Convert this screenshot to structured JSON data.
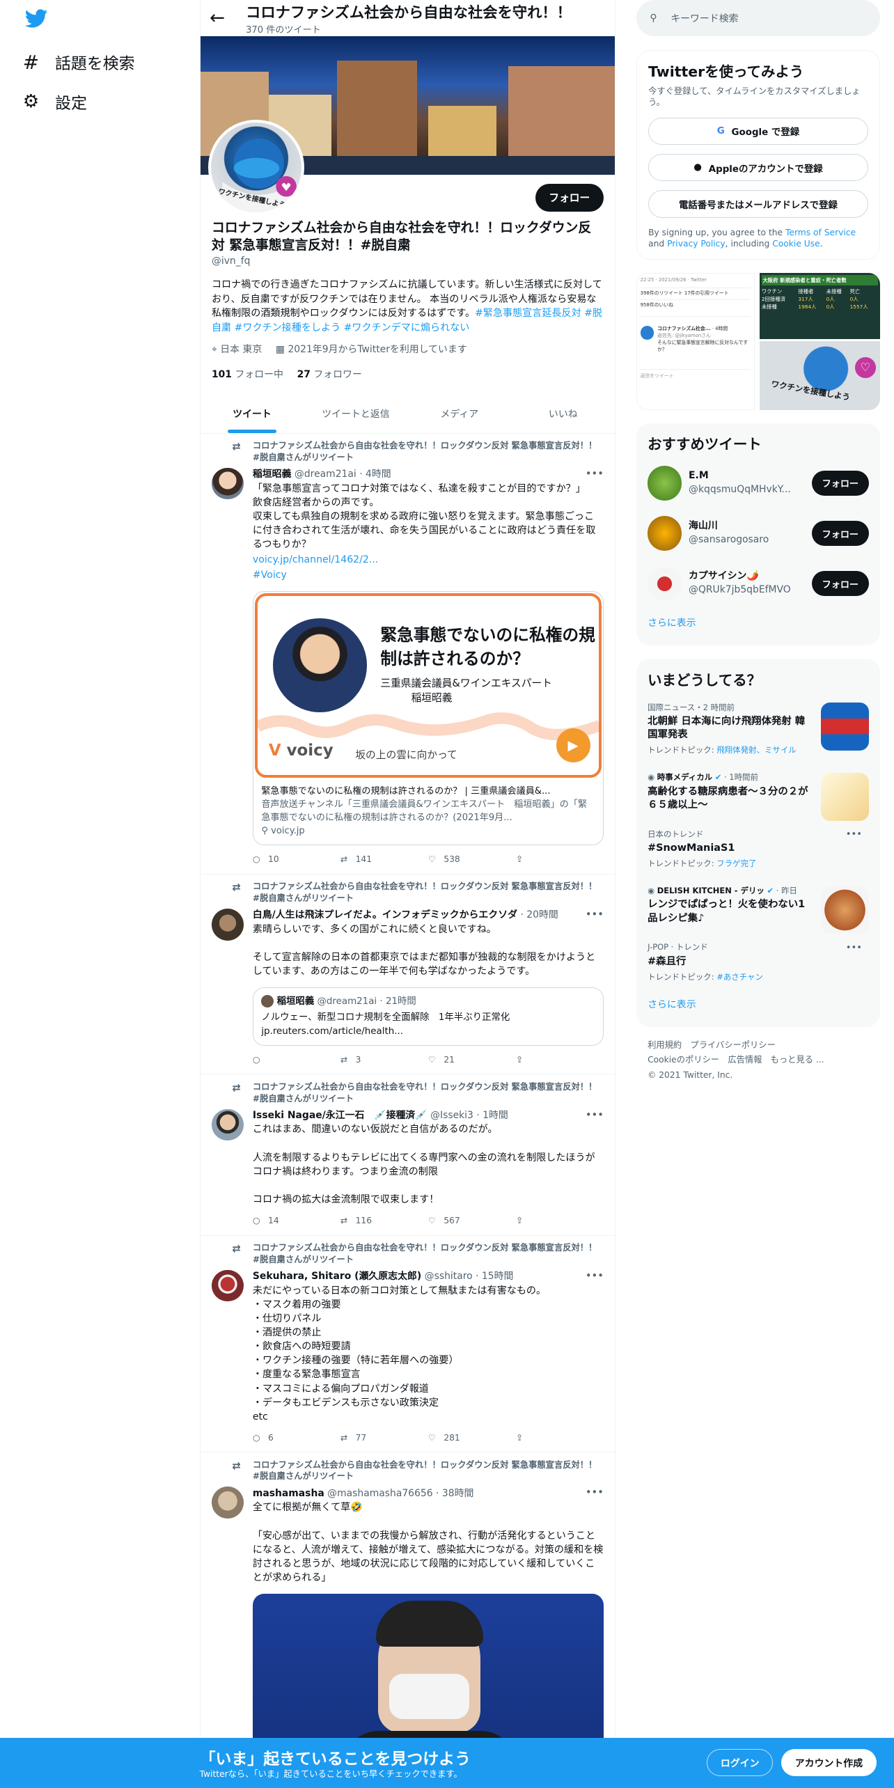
{
  "nav": {
    "explore": "話題を検索",
    "settings": "設定"
  },
  "header": {
    "title": "コロナファシズム社会から自由な社会を守れ！！ロックダウン反対 緊急事態宣言反対！！#脱自粛",
    "tweet_count": "370 件のツイート"
  },
  "profile": {
    "follow": "フォロー",
    "name": "コロナファシズム社会から自由な社会を守れ！！ロックダウン反対 緊急事態宣言反対！！#脱自粛",
    "handle": "@ivn_fq",
    "bio": "コロナ禍での行き過ぎたコロナファシズムに抗議しています。新しい生活様式に反対しており、反自粛ですが反ワクチンでは在りません。 本当のリベラル派や人権派なら安易な私権制限の酒類規制やロックダウンには反対するはずです。",
    "bio_tags": "#緊急事態宣言延長反対 #脱自粛 #ワクチン接種をしよう #ワクチンデマに煽られない",
    "location": "日本 東京",
    "joined": "2021年9月からTwitterを利用しています",
    "following": "101",
    "following_label": "フォロー中",
    "followers": "27",
    "followers_label": "フォロワー",
    "avatar_text": "ワクチンを接種しよう"
  },
  "tabs": [
    "ツイート",
    "ツイートと返信",
    "メディア",
    "いいね"
  ],
  "tweets": [
    {
      "rt": "コロナファシズム社会から自由な社会を守れ！！ロックダウン反対 緊急事態宣言反対！！#脱自粛さんがリツイート",
      "name": "稲垣昭義",
      "handle": "@dream21ai",
      "time": "· 4時間",
      "body": "「緊急事態宣言ってコロナ対策ではなく、私達を殺すことが目的ですか？」\n飲食店経営者からの声です。\n収束しても県独自の規制を求める政府に強い怒りを覚えます。緊急事態ごっこに付き合わされて生活が壊れ、命を失う国民がいることに政府はどう責任を取るつもりか？",
      "link": "voicy.jp/channel/1462/2...",
      "tag": "#Voicy",
      "card": {
        "headline": "緊急事態でないのに私権の規制は許されるのか？",
        "sub1": "三重県議会議員&ワインエキスパート",
        "sub2": "稲垣昭義",
        "brand": "voicy",
        "tagline": "坂の上の雲に向かって",
        "title": "緊急事態でないのに私権の規制は許されるのか？ | 三重県議会議員&...",
        "desc": "音声放送チャンネル「三重県議会議員&ワインエキスパート　稲垣昭義」の「緊急事態でないのに私権の規制は許されるのか？(2021年9月...",
        "domain": "voicy.jp"
      },
      "reply": "10",
      "retweet": "141",
      "like": "538"
    },
    {
      "rt": "コロナファシズム社会から自由な社会を守れ！！ロックダウン反対 緊急事態宣言反対！！#脱自粛さんがリツイート",
      "name": "白鳥/人生は飛沫プレイだよ。インフォデミックからエクソダ",
      "handle": "",
      "time": "· 20時間",
      "body": "素晴らしいです、多くの国がこれに続くと良いですね。\n\nそして宣言解除の日本の首都東京ではまだ都知事が独裁的な制限をかけようとしています、あの方はこの一年半で何も学ばなかったようです。",
      "quote": {
        "name": "稲垣昭義",
        "handle": "@dream21ai",
        "time": "· 21時間",
        "text": "ノルウェー、新型コロナ規制を全面解除　1年半ぶり正常化",
        "link": "jp.reuters.com/article/health..."
      },
      "reply": "",
      "retweet": "3",
      "like": "21"
    },
    {
      "rt": "コロナファシズム社会から自由な社会を守れ！！ロックダウン反対 緊急事態宣言反対！！#脱自粛さんがリツイート",
      "name": "Isseki Nagae/永江一石　💉接種済💉",
      "handle": "@Isseki3",
      "time": "· 1時間",
      "body": "これはまあ、間違いのない仮説だと自信があるのだが。\n\n人流を制限するよりもテレビに出てくる専門家への金の流れを制限したほうがコロナ禍は終わります。つまり金流の制限\n\nコロナ禍の拡大は金流制限で収束します！",
      "reply": "14",
      "retweet": "116",
      "like": "567"
    },
    {
      "rt": "コロナファシズム社会から自由な社会を守れ！！ロックダウン反対 緊急事態宣言反対！！#脱自粛さんがリツイート",
      "name": "Sekuhara, Shitaro (瀬久原志太郎)",
      "handle": "@sshitaro",
      "time": "· 15時間",
      "body": "未だにやっている日本の新コロ対策として無駄または有害なもの。\n・マスク着用の強要\n・仕切りパネル\n・酒提供の禁止\n・飲食店への時短要請\n・ワクチン接種の強要（特に若年層への強要）\n・度重なる緊急事態宣言\n・マスコミによる偏向プロパガンダ報道\n・データもエビデンスも示さない政策決定\netc",
      "reply": "6",
      "retweet": "77",
      "like": "281"
    },
    {
      "rt": "コロナファシズム社会から自由な社会を守れ！！ロックダウン反対 緊急事態宣言反対！！#脱自粛さんがリツイート",
      "name": "mashamasha",
      "handle": "@mashamasha76656",
      "time": "· 38時間",
      "body": "全てに根拠が無くて草🤣\n\n「安心感が出て、いままでの我慢から解放され、行動が活発化するということになると、人流が増えて、接触が増えて、感染拡大につながる。対策の緩和を検討されると思うが、地域の状況に応じて段階的に対応していく緩和していくことが求められる」"
    }
  ],
  "search": {
    "placeholder": "キーワード検索"
  },
  "signup": {
    "title": "Twitterを使ってみよう",
    "sub": "今すぐ登録して、タイムラインをカスタマイズしましょう。",
    "google": "Google で登録",
    "apple": "Appleのアカウントで登録",
    "phone": "電話番号またはメールアドレスで登録",
    "terms_pre": "By signing up, you agree to the ",
    "terms": "Terms of Service",
    "and": " and ",
    "privacy": "Privacy Policy",
    "incl": ", including ",
    "cookie": "Cookie Use",
    "dot": "."
  },
  "media": {
    "date": "22:25 · 2021/09/26 · Twitter",
    "stats1": "398件のリツイート 17件の引用ツイート",
    "stats2": "958件のいいね",
    "prof_name": "コロナファシズム社会...",
    "prof_time": "· 4時間",
    "prof_reply": "返信先: @jikyamonさん",
    "prof_text": "そんなに緊急事態宣言解除に反対なんですか？",
    "reply_box": "返信をツイート",
    "chart_title": "大阪府 新規感染者と重症・死亡者数",
    "rows": [
      [
        "ワクチン",
        "接種者",
        "未接種",
        "死亡"
      ],
      [
        "2回接種済",
        "317人",
        "0人",
        "0人"
      ],
      [
        "未接種",
        "1984人",
        "0人",
        "1557人"
      ]
    ],
    "badge": "ワクチンを接種しよう"
  },
  "recs": {
    "title": "おすすめツイート",
    "follow": "フォロー",
    "items": [
      {
        "name": "E.M",
        "handle": "@kqqsmuQqMHvkY..."
      },
      {
        "name": "海山川",
        "handle": "@sansarogosaro"
      },
      {
        "name": "カプサイシン🌶️",
        "handle": "@QRUk7jb5qbEfMVO"
      }
    ],
    "more": "さらに表示"
  },
  "trends": {
    "title": "いまどうしてる？",
    "items": [
      {
        "cat": "国際ニュース・2 時間前",
        "title": "北朝鮮 日本海に向け飛翔体発射 韓国軍発表",
        "topic_label": "トレンドトピック: ",
        "topic": "飛翔体発射、ミサイル"
      },
      {
        "cat": "時事メディカル",
        "time": "· 1時間前",
        "title": "高齢化する糖尿病患者～３分の２が６５歳以上～",
        "topic_label": "",
        "topic": ""
      },
      {
        "cat": "日本のトレンド",
        "title": "#SnowManiaS1",
        "topic_label": "トレンドトピック: ",
        "topic": "フラゲ完了"
      },
      {
        "cat": "DELISH KITCHEN - デリッ",
        "time": "· 昨日",
        "title": "レンジでぱぱっと！火を使わない1品レシピ集♪",
        "topic_label": "",
        "topic": ""
      },
      {
        "cat": "J-POP · トレンド",
        "title": "#森且行",
        "topic_label": "トレンドトピック: ",
        "topic": "#あさチャン"
      }
    ],
    "more": "さらに表示"
  },
  "footer": {
    "l1": "利用規約　プライバシーポリシー",
    "l2": "Cookieのポリシー　広告情報　もっと見る ...",
    "l3": "© 2021 Twitter, Inc."
  },
  "bottom": {
    "main": "「いま」起きていることを見つけよう",
    "sub": "Twitterなら、「いま」起きていることをいち早くチェックできます。",
    "login": "ログイン",
    "signup": "アカウント作成"
  },
  "colors": {
    "accent": "#1d9bf0",
    "voicy": "#f07f3c"
  }
}
